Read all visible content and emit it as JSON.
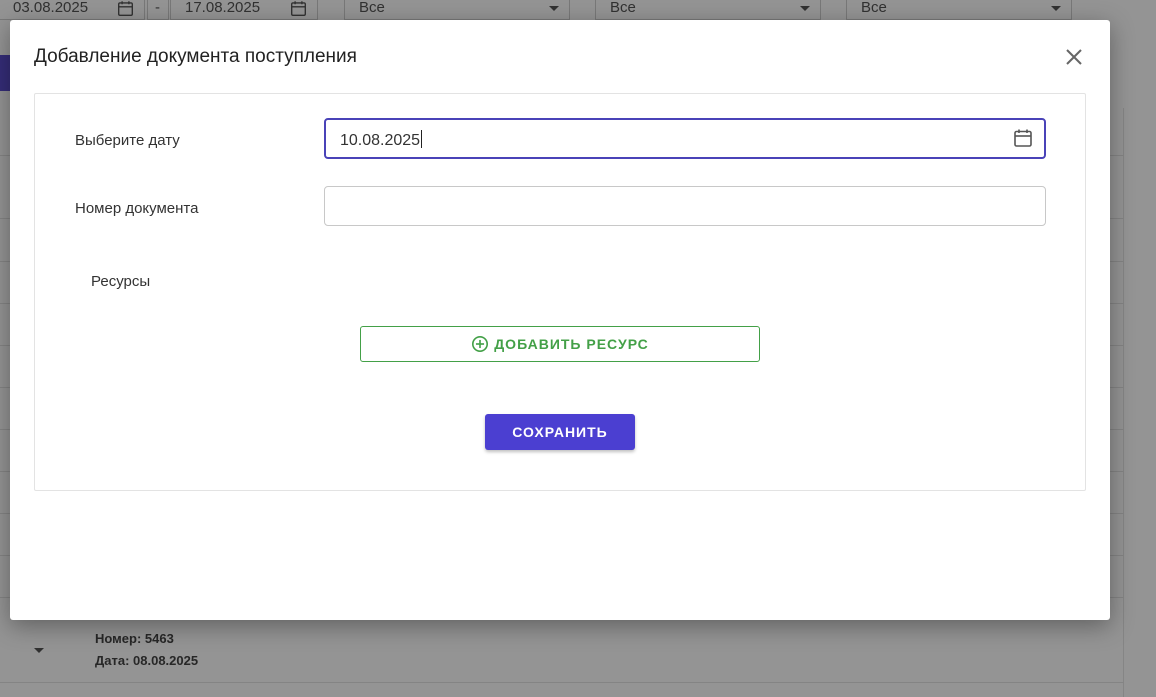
{
  "filters": {
    "date_from": "03.08.2025",
    "date_separator": "-",
    "date_to": "17.08.2025",
    "select_1": "Все",
    "select_2": "Все",
    "select_3": "Все"
  },
  "list_item": {
    "number": "Номер: 5463",
    "date": "Дата: 08.08.2025"
  },
  "modal": {
    "title": "Добавление документа поступления",
    "date_label": "Выберите дату",
    "date_value": "10.08.2025",
    "doc_number_label": "Номер документа",
    "doc_number_value": "",
    "resources_label": "Ресурсы",
    "add_resource_label": "ДОБАВИТЬ РЕСУРС",
    "save_label": "СОХРАНИТЬ"
  },
  "colors": {
    "primary": "#4b3fd1",
    "accent_green": "#43a047",
    "focus_border": "#4a43b8"
  },
  "icons": [
    "calendar-icon",
    "chevron-down-icon",
    "close-icon",
    "plus-circle-icon"
  ]
}
